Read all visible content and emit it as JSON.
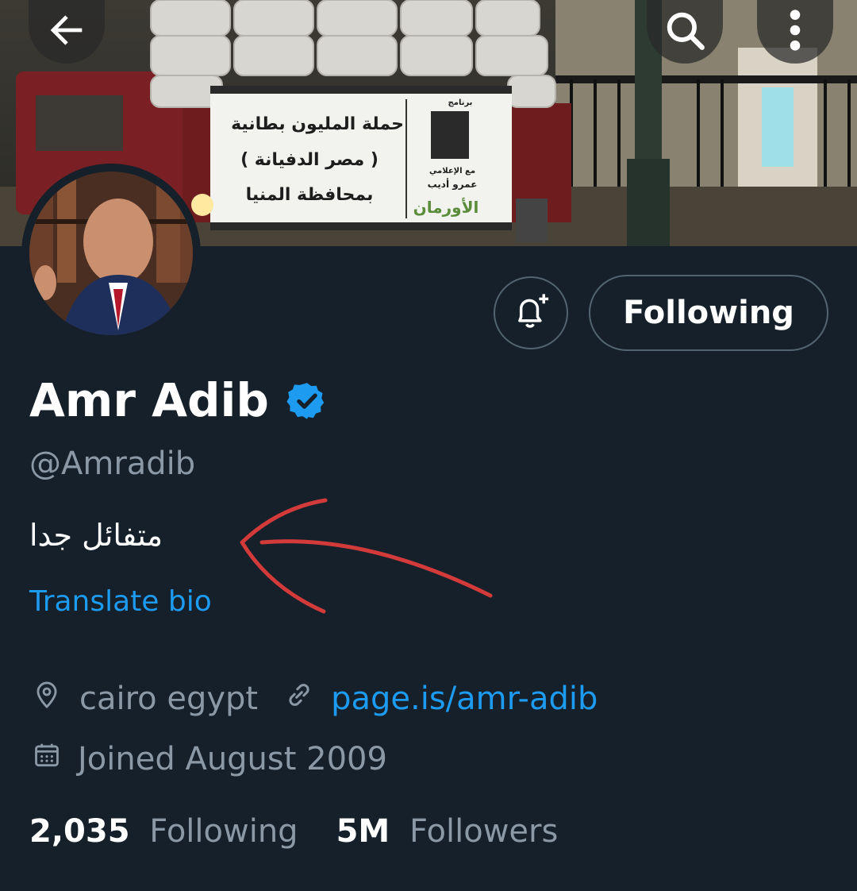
{
  "banner": {
    "sign_lines": [
      "حملة المليون بطانية",
      "( مصر الدفيانة )",
      "بمحافظة المنيا"
    ],
    "sign_side_top": "برنامج",
    "sign_side_credit_1": "مع الإعلامي",
    "sign_side_credit_2": "عمرو أديب",
    "sign_side_logo": "الأورمان"
  },
  "header": {
    "back_icon": "arrow-left-icon",
    "search_icon": "search-icon",
    "more_icon": "more-vertical-icon"
  },
  "actions": {
    "notify_icon": "bell-plus-icon",
    "following_label": "Following"
  },
  "profile": {
    "name": "Amr Adib",
    "verified_icon": "verified-badge-icon",
    "handle": "@Amradib",
    "bio": "متفائل جدا",
    "translate_label": "Translate bio",
    "location": "cairo egypt",
    "website": "page.is/amr-adib",
    "joined": "Joined August 2009"
  },
  "stats": {
    "following_count": "2,035",
    "following_label": "Following",
    "followers_count": "5M",
    "followers_label": "Followers"
  },
  "colors": {
    "background": "#15202b",
    "accent": "#1d9bf0",
    "muted": "#8b98a5",
    "annotation": "#d33a3a"
  }
}
